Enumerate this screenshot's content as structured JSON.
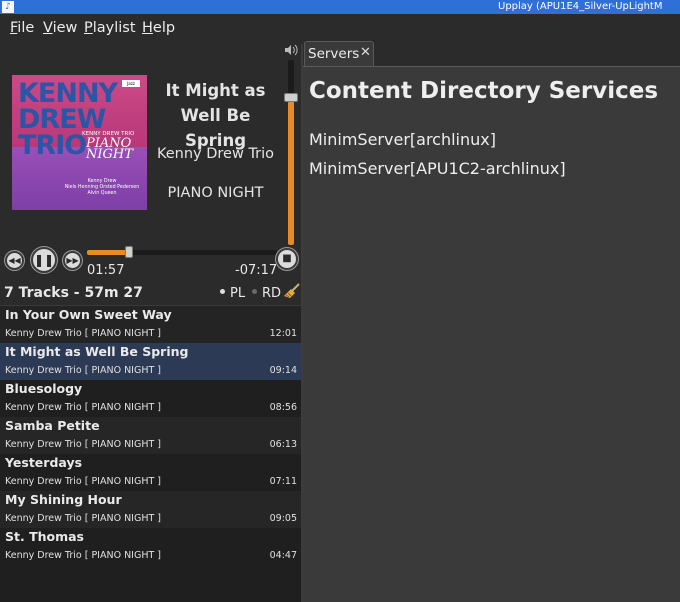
{
  "window": {
    "title": "Upplay (APU1E4_Silver-UpLightM"
  },
  "menu": [
    {
      "mnemonic": "F",
      "rest": "ile"
    },
    {
      "mnemonic": "V",
      "rest": "iew"
    },
    {
      "mnemonic": "P",
      "rest": "laylist"
    },
    {
      "mnemonic": "H",
      "rest": "elp"
    }
  ],
  "cover": {
    "line1": "KENNY",
    "line2": "DREW",
    "line3": "TRIO",
    "small": "KENNY DREW TRIO",
    "piano": "PIANO",
    "night": "NIGHT",
    "credits1": "Kenny Drew",
    "credits2": "Niels Henning Orsted Pedersen",
    "credits3": "Alvin Queen"
  },
  "now_playing": {
    "title": "It Might as Well Be Spring",
    "artist": "Kenny Drew Trio",
    "album": "PIANO NIGHT"
  },
  "transport": {
    "elapsed": "01:57",
    "remaining": "-07:17",
    "progress": 0.21,
    "volume": 0.8
  },
  "playlist_header": {
    "summary": "7 Tracks - 57m 27",
    "pl_label": "PL",
    "rd_label": "RD"
  },
  "tracks": [
    {
      "title": "In Your Own Sweet Way",
      "meta": "Kenny Drew Trio  [ PIANO NIGHT ]",
      "duration": "12:01",
      "bg": "#242424"
    },
    {
      "title": "It Might as Well Be Spring",
      "meta": "Kenny Drew Trio  [ PIANO NIGHT ]",
      "duration": "09:14",
      "bg": "#2c3a55"
    },
    {
      "title": "Bluesology",
      "meta": "Kenny Drew Trio  [ PIANO NIGHT ]",
      "duration": "08:56",
      "bg": "#1f1f1f"
    },
    {
      "title": "Samba Petite",
      "meta": "Kenny Drew Trio  [ PIANO NIGHT ]",
      "duration": "06:13",
      "bg": "#262626"
    },
    {
      "title": "Yesterdays",
      "meta": "Kenny Drew Trio  [ PIANO NIGHT ]",
      "duration": "07:11",
      "bg": "#1f1f1f"
    },
    {
      "title": "My Shining Hour",
      "meta": "Kenny Drew Trio  [ PIANO NIGHT ]",
      "duration": "09:05",
      "bg": "#262626"
    },
    {
      "title": "St. Thomas",
      "meta": "Kenny Drew Trio  [ PIANO NIGHT ]",
      "duration": "04:47",
      "bg": "#1f1f1f"
    }
  ],
  "servers_tab": {
    "label": "Servers",
    "close": "✕"
  },
  "right_panel": {
    "heading": "Content Directory Services",
    "servers": [
      "MinimServer[archlinux]",
      "MinimServer[APU1C2-archlinux]"
    ]
  },
  "icons": {
    "prev": "◀◀",
    "pause": "❚❚",
    "next": "▶▶",
    "stop": "■",
    "volume": "speaker-icon",
    "clear": "broom-icon"
  },
  "colors": {
    "accent": "#e88a26",
    "selection": "#2c3a55",
    "titlebar": "#2f6fd8"
  }
}
